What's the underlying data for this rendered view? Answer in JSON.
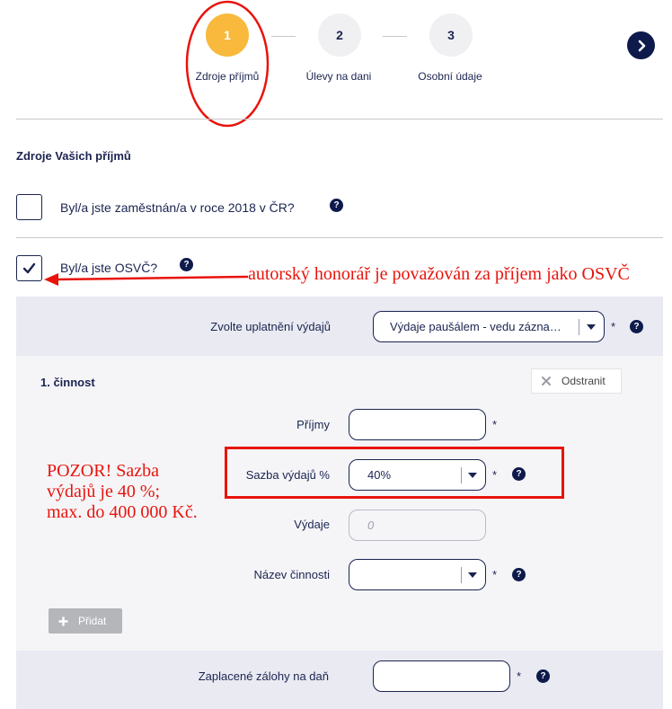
{
  "stepper": {
    "steps": [
      {
        "number": "1",
        "label": "Zdroje příjmů"
      },
      {
        "number": "2",
        "label": "Úlevy na dani"
      },
      {
        "number": "3",
        "label": "Osobní údaje"
      }
    ],
    "next_icon": "chevron-right-icon"
  },
  "section_title": "Zdroje Vašich příjmů",
  "questions": {
    "employed_label": "Byl/a jste zaměstnán/a v roce 2018 v ČR?",
    "employed_checked": false,
    "osvc_label": "Byl/a jste OSVČ?",
    "osvc_checked": true
  },
  "help_symbol": "?",
  "required_symbol": "*",
  "expense_method": {
    "label": "Zvolte uplatnění výdajů",
    "value": "Výdaje paušálem - vedu zázna…"
  },
  "activity": {
    "title": "1. činnost",
    "remove_label": "Odstranit",
    "income_label": "Příjmy",
    "income_value": "",
    "rate_label": "Sazba výdajů %",
    "rate_value": "40%",
    "expenses_label": "Výdaje",
    "expenses_placeholder": "0",
    "activity_name_label": "Název činnosti",
    "activity_name_value": "",
    "add_label": "Přidat"
  },
  "advances": {
    "label": "Zaplacené zálohy na daň",
    "value": ""
  },
  "annotations": {
    "osvc_note": "autorský honorář je považován za příjem jako OSVČ",
    "rate_note_line1": "POZOR! Sazba",
    "rate_note_line2": "výdajů je 40 %;",
    "rate_note_line3": "max. do 400 000 Kč.",
    "color": "#e8140c"
  }
}
